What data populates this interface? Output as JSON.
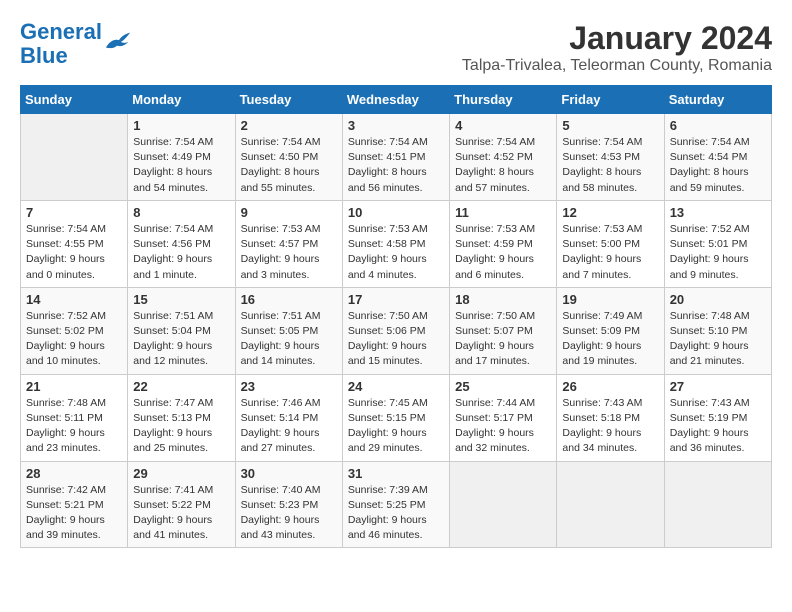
{
  "logo": {
    "text_general": "General",
    "text_blue": "Blue"
  },
  "title": "January 2024",
  "subtitle": "Talpa-Trivalea, Teleorman County, Romania",
  "days_header": [
    "Sunday",
    "Monday",
    "Tuesday",
    "Wednesday",
    "Thursday",
    "Friday",
    "Saturday"
  ],
  "weeks": [
    [
      {
        "num": "",
        "sunrise": "",
        "sunset": "",
        "daylight": ""
      },
      {
        "num": "1",
        "sunrise": "Sunrise: 7:54 AM",
        "sunset": "Sunset: 4:49 PM",
        "daylight": "Daylight: 8 hours and 54 minutes."
      },
      {
        "num": "2",
        "sunrise": "Sunrise: 7:54 AM",
        "sunset": "Sunset: 4:50 PM",
        "daylight": "Daylight: 8 hours and 55 minutes."
      },
      {
        "num": "3",
        "sunrise": "Sunrise: 7:54 AM",
        "sunset": "Sunset: 4:51 PM",
        "daylight": "Daylight: 8 hours and 56 minutes."
      },
      {
        "num": "4",
        "sunrise": "Sunrise: 7:54 AM",
        "sunset": "Sunset: 4:52 PM",
        "daylight": "Daylight: 8 hours and 57 minutes."
      },
      {
        "num": "5",
        "sunrise": "Sunrise: 7:54 AM",
        "sunset": "Sunset: 4:53 PM",
        "daylight": "Daylight: 8 hours and 58 minutes."
      },
      {
        "num": "6",
        "sunrise": "Sunrise: 7:54 AM",
        "sunset": "Sunset: 4:54 PM",
        "daylight": "Daylight: 8 hours and 59 minutes."
      }
    ],
    [
      {
        "num": "7",
        "sunrise": "Sunrise: 7:54 AM",
        "sunset": "Sunset: 4:55 PM",
        "daylight": "Daylight: 9 hours and 0 minutes."
      },
      {
        "num": "8",
        "sunrise": "Sunrise: 7:54 AM",
        "sunset": "Sunset: 4:56 PM",
        "daylight": "Daylight: 9 hours and 1 minute."
      },
      {
        "num": "9",
        "sunrise": "Sunrise: 7:53 AM",
        "sunset": "Sunset: 4:57 PM",
        "daylight": "Daylight: 9 hours and 3 minutes."
      },
      {
        "num": "10",
        "sunrise": "Sunrise: 7:53 AM",
        "sunset": "Sunset: 4:58 PM",
        "daylight": "Daylight: 9 hours and 4 minutes."
      },
      {
        "num": "11",
        "sunrise": "Sunrise: 7:53 AM",
        "sunset": "Sunset: 4:59 PM",
        "daylight": "Daylight: 9 hours and 6 minutes."
      },
      {
        "num": "12",
        "sunrise": "Sunrise: 7:53 AM",
        "sunset": "Sunset: 5:00 PM",
        "daylight": "Daylight: 9 hours and 7 minutes."
      },
      {
        "num": "13",
        "sunrise": "Sunrise: 7:52 AM",
        "sunset": "Sunset: 5:01 PM",
        "daylight": "Daylight: 9 hours and 9 minutes."
      }
    ],
    [
      {
        "num": "14",
        "sunrise": "Sunrise: 7:52 AM",
        "sunset": "Sunset: 5:02 PM",
        "daylight": "Daylight: 9 hours and 10 minutes."
      },
      {
        "num": "15",
        "sunrise": "Sunrise: 7:51 AM",
        "sunset": "Sunset: 5:04 PM",
        "daylight": "Daylight: 9 hours and 12 minutes."
      },
      {
        "num": "16",
        "sunrise": "Sunrise: 7:51 AM",
        "sunset": "Sunset: 5:05 PM",
        "daylight": "Daylight: 9 hours and 14 minutes."
      },
      {
        "num": "17",
        "sunrise": "Sunrise: 7:50 AM",
        "sunset": "Sunset: 5:06 PM",
        "daylight": "Daylight: 9 hours and 15 minutes."
      },
      {
        "num": "18",
        "sunrise": "Sunrise: 7:50 AM",
        "sunset": "Sunset: 5:07 PM",
        "daylight": "Daylight: 9 hours and 17 minutes."
      },
      {
        "num": "19",
        "sunrise": "Sunrise: 7:49 AM",
        "sunset": "Sunset: 5:09 PM",
        "daylight": "Daylight: 9 hours and 19 minutes."
      },
      {
        "num": "20",
        "sunrise": "Sunrise: 7:48 AM",
        "sunset": "Sunset: 5:10 PM",
        "daylight": "Daylight: 9 hours and 21 minutes."
      }
    ],
    [
      {
        "num": "21",
        "sunrise": "Sunrise: 7:48 AM",
        "sunset": "Sunset: 5:11 PM",
        "daylight": "Daylight: 9 hours and 23 minutes."
      },
      {
        "num": "22",
        "sunrise": "Sunrise: 7:47 AM",
        "sunset": "Sunset: 5:13 PM",
        "daylight": "Daylight: 9 hours and 25 minutes."
      },
      {
        "num": "23",
        "sunrise": "Sunrise: 7:46 AM",
        "sunset": "Sunset: 5:14 PM",
        "daylight": "Daylight: 9 hours and 27 minutes."
      },
      {
        "num": "24",
        "sunrise": "Sunrise: 7:45 AM",
        "sunset": "Sunset: 5:15 PM",
        "daylight": "Daylight: 9 hours and 29 minutes."
      },
      {
        "num": "25",
        "sunrise": "Sunrise: 7:44 AM",
        "sunset": "Sunset: 5:17 PM",
        "daylight": "Daylight: 9 hours and 32 minutes."
      },
      {
        "num": "26",
        "sunrise": "Sunrise: 7:43 AM",
        "sunset": "Sunset: 5:18 PM",
        "daylight": "Daylight: 9 hours and 34 minutes."
      },
      {
        "num": "27",
        "sunrise": "Sunrise: 7:43 AM",
        "sunset": "Sunset: 5:19 PM",
        "daylight": "Daylight: 9 hours and 36 minutes."
      }
    ],
    [
      {
        "num": "28",
        "sunrise": "Sunrise: 7:42 AM",
        "sunset": "Sunset: 5:21 PM",
        "daylight": "Daylight: 9 hours and 39 minutes."
      },
      {
        "num": "29",
        "sunrise": "Sunrise: 7:41 AM",
        "sunset": "Sunset: 5:22 PM",
        "daylight": "Daylight: 9 hours and 41 minutes."
      },
      {
        "num": "30",
        "sunrise": "Sunrise: 7:40 AM",
        "sunset": "Sunset: 5:23 PM",
        "daylight": "Daylight: 9 hours and 43 minutes."
      },
      {
        "num": "31",
        "sunrise": "Sunrise: 7:39 AM",
        "sunset": "Sunset: 5:25 PM",
        "daylight": "Daylight: 9 hours and 46 minutes."
      },
      {
        "num": "",
        "sunrise": "",
        "sunset": "",
        "daylight": ""
      },
      {
        "num": "",
        "sunrise": "",
        "sunset": "",
        "daylight": ""
      },
      {
        "num": "",
        "sunrise": "",
        "sunset": "",
        "daylight": ""
      }
    ]
  ]
}
